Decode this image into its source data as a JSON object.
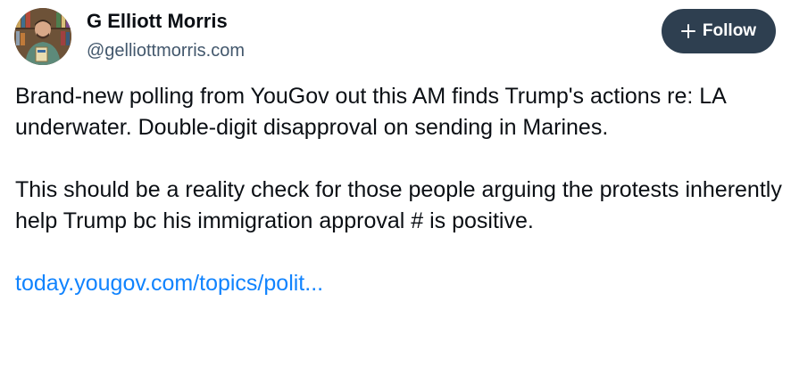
{
  "author": {
    "name": "G Elliott Morris",
    "handle": "@gelliottmorris.com",
    "avatar_icon": "profile-photo"
  },
  "follow_button": {
    "label": "Follow",
    "icon": "plus-icon",
    "bg_color": "#2e3f50"
  },
  "post": {
    "paragraphs": [
      "Brand-new polling from YouGov out this AM finds Trump's actions re: LA underwater. Double-digit disapproval on sending in Marines.",
      "This should be a reality check for those people arguing the protests inherently help Trump bc his immigration approval # is positive."
    ],
    "link_text": "today.yougov.com/topics/polit...",
    "link_color": "#1083fe"
  }
}
